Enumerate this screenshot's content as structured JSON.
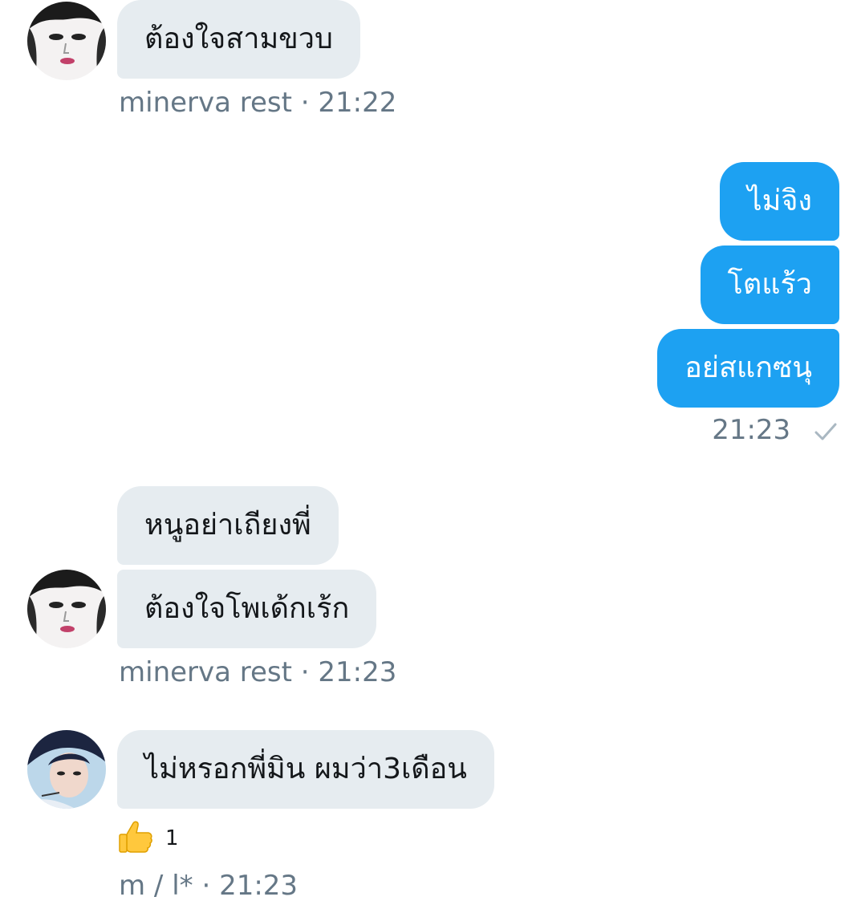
{
  "conversation": {
    "group1": {
      "message": "ต้องใจสามขวบ",
      "sender": "minerva rest",
      "time": "21:22"
    },
    "outgoing": {
      "messages": [
        "ไม่จิง",
        "โตแร้ว",
        "อย่สแกซนุ"
      ],
      "time": "21:23"
    },
    "group2": {
      "messages": [
        "หนูอย่าเถียงพี่",
        "ต้องใจโพเด้กเร้ก"
      ],
      "sender": "minerva rest",
      "time": "21:23"
    },
    "group3": {
      "message": "ไม่หรอกพี่มิน ผมว่า3เดือน",
      "reaction_count": "1",
      "sender": "m / l*",
      "time": "21:23"
    }
  },
  "colors": {
    "incoming_bubble": "#e6ecf0",
    "outgoing_bubble": "#1da1f2",
    "meta_text": "#657786",
    "checkmark": "#aab8c2"
  },
  "icons": {
    "sent_status": "checkmark-icon",
    "reaction": "thumbs-up-icon"
  }
}
